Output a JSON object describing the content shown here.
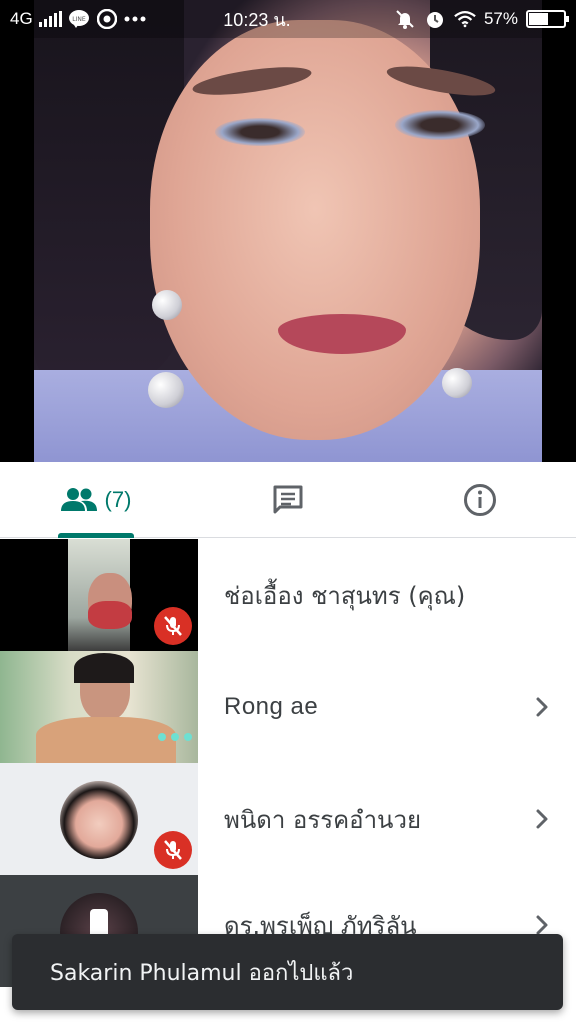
{
  "status_bar": {
    "network": "4G",
    "time": "10:23 น.",
    "battery": "57%",
    "battery_level": 0.57,
    "icons": [
      "signal-icon",
      "line-app-icon",
      "chrome-icon",
      "more-dots-icon",
      "mute-notification-icon",
      "alarm-icon",
      "wifi-icon",
      "battery-charging-icon"
    ]
  },
  "tabs": [
    {
      "name": "people",
      "icon": "people-icon",
      "count": "(7)",
      "active": true
    },
    {
      "name": "chat",
      "icon": "chat-icon",
      "active": false
    },
    {
      "name": "info",
      "icon": "info-icon",
      "active": false
    }
  ],
  "participants": [
    {
      "name": "ช่อเอื้อง ชาสุนทร (คุณ)",
      "muted": true,
      "has_chevron": false
    },
    {
      "name": "Rong ae",
      "muted": false,
      "speaking": true,
      "has_chevron": true
    },
    {
      "name": "พนิดา อรรคอำนวย",
      "muted": true,
      "has_chevron": true
    },
    {
      "name": "ดร.พรเพ็ญ ภัทริลัน",
      "has_chevron": true
    }
  ],
  "toast": {
    "message": "Sakarin Phulamul ออกไปแล้ว"
  },
  "colors": {
    "accent": "#00796b",
    "mute": "#d93025",
    "toast_bg": "#2b2d30"
  }
}
